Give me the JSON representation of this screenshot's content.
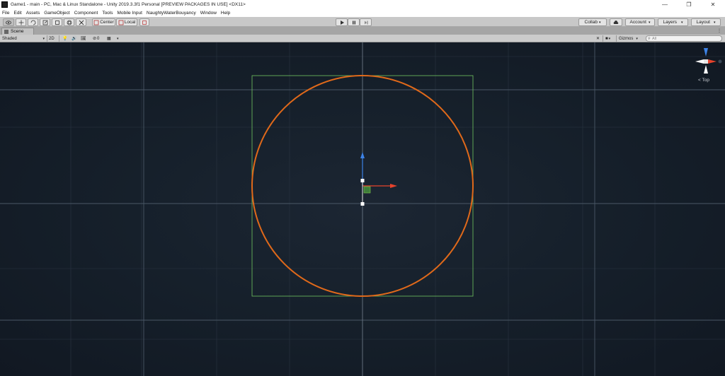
{
  "window": {
    "title": "Game1 - main - PC, Mac & Linux Standalone - Unity 2019.3.3f1 Personal [PREVIEW PACKAGES IN USE] <DX11>",
    "minimize": "—",
    "maximize": "❐",
    "close": "✕"
  },
  "menu": {
    "items": [
      "File",
      "Edit",
      "Assets",
      "GameObject",
      "Component",
      "Tools",
      "Mobile Input",
      "NaughtyWaterBouyancy",
      "Window",
      "Help"
    ]
  },
  "toolbar": {
    "pivot_label": "Center",
    "space_label": "Local",
    "collab_label": "Collab",
    "account_label": "Account",
    "layers_label": "Layers",
    "layout_label": "Layout"
  },
  "scene": {
    "tab_label": "Scene",
    "shading_mode": "Shaded",
    "mode_2d": "2D",
    "effects_count": "0",
    "gizmos_label": "Gizmos",
    "search_placeholder": "All",
    "view_label": "Top"
  },
  "colors": {
    "circle": "#e0691a",
    "box": "#66b35a",
    "x_axis": "#e8432c",
    "y_axis": "#7ec84b",
    "z_axis": "#3d82e6"
  },
  "icons": {
    "hand_tool": "hand-icon",
    "move_tool": "move-icon",
    "rotate_tool": "rotate-icon",
    "scale_tool": "scale-icon",
    "rect_tool": "rect-icon",
    "transform_tool": "transform-icon",
    "custom_tool": "custom-tool-icon",
    "play": "play-icon",
    "pause": "pause-icon",
    "step": "step-icon",
    "cloud": "cloud-icon"
  }
}
